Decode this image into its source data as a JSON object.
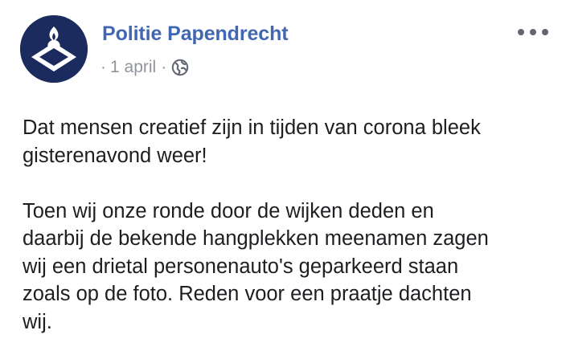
{
  "post": {
    "author": "Politie Papendrecht",
    "date": "1 april",
    "audience_icon": "globe-icon",
    "more_icon": "more-options-icon",
    "paragraphs": [
      "Dat mensen creatief zijn in tijden van corona bleek\ngisterenavond weer!",
      "Toen wij onze ronde door de wijken deden en\ndaarbij de bekende hangplekken meenamen zagen\nwij een drietal personenauto's geparkeerd staan\nzoals op de foto. Reden voor een praatje dachten\nwij."
    ]
  },
  "colors": {
    "author": "#4267b2",
    "meta": "#90949c",
    "text": "#1c1e21",
    "avatar_bg": "#1b2b5e"
  }
}
